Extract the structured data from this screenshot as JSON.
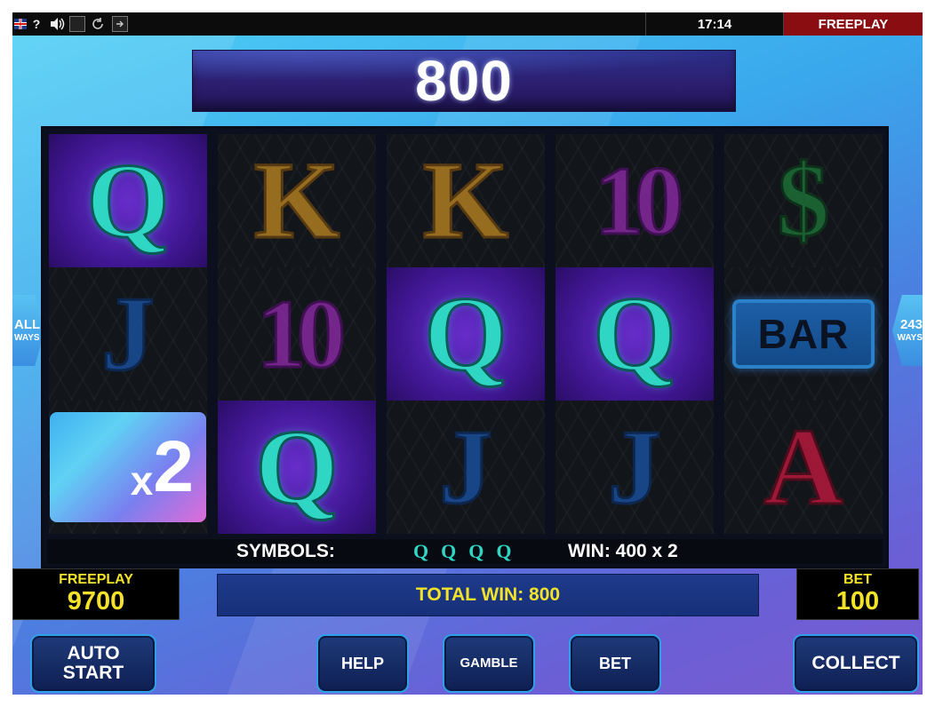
{
  "topbar": {
    "icons": [
      "uk-flag-icon",
      "help-icon",
      "sound-icon",
      "fullscreen-icon",
      "refresh-icon",
      "exit-icon"
    ],
    "help_glyph": "?",
    "time": "17:14",
    "mode": "FREEPLAY"
  },
  "win_display": {
    "value": "800"
  },
  "ways": {
    "left": {
      "big": "ALL",
      "small": "WAYS"
    },
    "right": {
      "big": "243",
      "small": "WAYS"
    }
  },
  "reels": [
    [
      "Q",
      "J",
      "x2"
    ],
    [
      "K",
      "10",
      "Q"
    ],
    [
      "K",
      "Q",
      "J"
    ],
    [
      "10",
      "Q",
      "J"
    ],
    [
      "$",
      "BAR",
      "A"
    ]
  ],
  "multiplier": {
    "x": "x",
    "n": "2"
  },
  "info": {
    "symbols_label": "SYMBOLS:",
    "symbols_icons": "QQQQ",
    "line_win": "WIN: 400 x 2"
  },
  "credit": {
    "label": "FREEPLAY",
    "value": "9700"
  },
  "bet": {
    "label": "BET",
    "value": "100"
  },
  "total_win": "TOTAL WIN: 800",
  "buttons": {
    "autostart_line1": "AUTO",
    "autostart_line2": "START",
    "help": "HELP",
    "gamble": "GAMBLE",
    "bet": "BET",
    "collect": "COLLECT"
  },
  "colors": {
    "panel_text": "#f2e32a",
    "mode_badge": "#8a0d12",
    "q_symbol": "#2fd6c4"
  }
}
